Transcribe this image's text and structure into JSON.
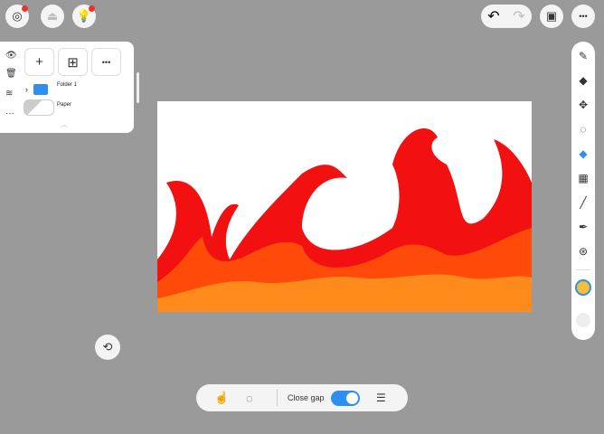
{
  "top_left": {
    "icons": [
      "spiral-icon",
      "upload-icon",
      "lightbulb-icon"
    ]
  },
  "top_right": {
    "undo": "↶",
    "redo": "↷",
    "gallery": "▣",
    "more": "•••"
  },
  "layers": {
    "add": "+",
    "add_folder": "⊞",
    "more": "•••",
    "folder_name": "Folder 1",
    "layer_name": "Paper",
    "side": [
      "👁",
      "🗑",
      "≋",
      "···"
    ]
  },
  "tools": {
    "items": [
      "pen",
      "eraser",
      "move",
      "lasso",
      "fill",
      "grid",
      "line",
      "eyedropper",
      "symmetry"
    ],
    "active": "fill",
    "color": "#f5c033"
  },
  "bottom_bar": {
    "close_gap_label": "Close gap",
    "close_gap_on": true
  },
  "colors": {
    "accent": "#2e8ff0",
    "red": "#f21010",
    "orange_red": "#ff4a0a",
    "orange": "#ff8a1c"
  }
}
